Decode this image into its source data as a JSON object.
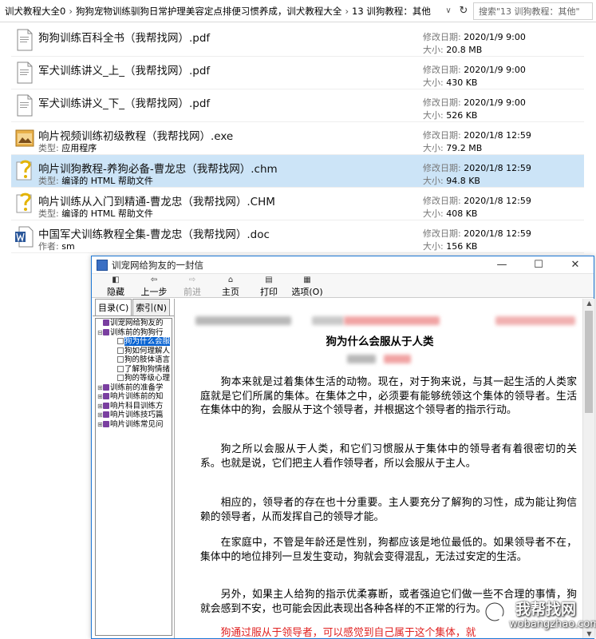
{
  "address_bar": {
    "crumbs": [
      "训犬教程大全0",
      "狗狗宠物训练驯狗日常护理美容定点排便习惯养成，训犬教程大全",
      "13 训狗教程：其他"
    ],
    "search_placeholder": "搜索\"13 训狗教程：其他\""
  },
  "files": [
    {
      "name": "狗狗训练百科全书（我帮找网）.pdf",
      "sub_label": "",
      "sub_value": "",
      "date_label": "修改日期:",
      "date": "2020/1/9 9:00",
      "size_label": "大小:",
      "size": "20.8 MB",
      "icon": "pdf-file-icon"
    },
    {
      "name": "军犬训练讲义_上_（我帮找网）.pdf",
      "sub_label": "",
      "sub_value": "",
      "date_label": "修改日期:",
      "date": "2020/1/9 9:00",
      "size_label": "大小:",
      "size": "430 KB",
      "icon": "pdf-file-icon"
    },
    {
      "name": "军犬训练讲义_下_（我帮找网）.pdf",
      "sub_label": "",
      "sub_value": "",
      "date_label": "修改日期:",
      "date": "2020/1/9 9:00",
      "size_label": "大小:",
      "size": "526 KB",
      "icon": "pdf-file-icon"
    },
    {
      "name": "响片视频训练初级教程（我帮找网）.exe",
      "sub_label": "类型:",
      "sub_value": "应用程序",
      "date_label": "修改日期:",
      "date": "2020/1/8 12:59",
      "size_label": "大小:",
      "size": "79.2 MB",
      "icon": "exe-file-icon"
    },
    {
      "name": "响片训狗教程-养狗必备-曹龙忠（我帮找网）.chm",
      "sub_label": "类型:",
      "sub_value": "编译的 HTML 帮助文件",
      "date_label": "修改日期:",
      "date": "2020/1/8 12:59",
      "size_label": "大小:",
      "size": "94.8 KB",
      "icon": "chm-file-icon"
    },
    {
      "name": "响片训练从入门到精通-曹龙忠（我帮找网）.CHM",
      "sub_label": "类型:",
      "sub_value": "编译的 HTML 帮助文件",
      "date_label": "修改日期:",
      "date": "2020/1/8 12:59",
      "size_label": "大小:",
      "size": "408 KB",
      "icon": "chm-file-icon"
    },
    {
      "name": "中国军犬训练教程全集-曹龙忠（我帮找网）.doc",
      "sub_label": "作者:",
      "sub_value": "sm",
      "date_label": "修改日期:",
      "date": "2020/1/8 12:59",
      "size_label": "大小:",
      "size": "156 KB",
      "icon": "word-file-icon"
    }
  ],
  "selected_file_index": 4,
  "help_window": {
    "title": "训宠网给狗友的一封信",
    "toolbar": [
      {
        "label": "隐藏",
        "icon": "hide-icon",
        "disabled": false
      },
      {
        "label": "上一步",
        "icon": "back-icon",
        "disabled": false
      },
      {
        "label": "前进",
        "icon": "forward-icon",
        "disabled": true
      },
      {
        "label": "主页",
        "icon": "home-icon",
        "disabled": false
      },
      {
        "label": "打印",
        "icon": "print-icon",
        "disabled": false
      },
      {
        "label": "选项(O)",
        "icon": "options-icon",
        "disabled": false
      }
    ],
    "tabs": [
      "目录(C)",
      "索引(N)"
    ],
    "tree": [
      {
        "label": "训宠网给狗友的",
        "level": 0,
        "box": "",
        "kind": "book",
        "hl": false
      },
      {
        "label": "训练前的狗狗行",
        "level": 0,
        "box": "⊟",
        "kind": "book",
        "hl": false
      },
      {
        "label": "狗为什么会服",
        "level": 1,
        "box": "",
        "kind": "page",
        "hl": true
      },
      {
        "label": "狗如何理解人",
        "level": 1,
        "box": "",
        "kind": "page",
        "hl": false
      },
      {
        "label": "狗的肢体语言",
        "level": 1,
        "box": "",
        "kind": "page",
        "hl": false
      },
      {
        "label": "了解狗狗情绪",
        "level": 1,
        "box": "",
        "kind": "page",
        "hl": false
      },
      {
        "label": "狗的等级心理",
        "level": 1,
        "box": "",
        "kind": "page",
        "hl": false
      },
      {
        "label": "训练前的准备学",
        "level": 0,
        "box": "⊞",
        "kind": "book",
        "hl": false
      },
      {
        "label": "响片训练前的知",
        "level": 0,
        "box": "⊞",
        "kind": "book",
        "hl": false
      },
      {
        "label": "响片科目训练方",
        "level": 0,
        "box": "⊞",
        "kind": "book",
        "hl": false
      },
      {
        "label": "响片训练技巧篇",
        "level": 0,
        "box": "⊞",
        "kind": "book",
        "hl": false
      },
      {
        "label": "响片训练常见问",
        "level": 0,
        "box": "⊞",
        "kind": "book",
        "hl": false
      }
    ],
    "doc_title": "狗为什么会服从于人类",
    "paragraphs": [
      "狗本来就是过着集体生活的动物。现在，对于狗来说，与其一起生活的人类家庭就是它们所属的集体。在集体之中，必须要有能够统领这个集体的领导者。生活在集体中的狗，会服从于这个领导者，并根据这个领导者的指示行动。",
      "狗之所以会服从于人类，和它们习惯服从于集体中的领导者有着很密切的关系。也就是说，它们把主人看作领导者，所以会服从于主人。",
      "相应的，领导者的存在也十分重要。主人要充分了解狗的习性，成为能让狗信赖的领导者，从而发挥自己的领导才能。",
      "在家庭中，不管是年龄还是性别，狗都应该是地位最低的。如果领导者不在，集体中的地位排列一旦发生变动，狗就会变得混乱，无法过安定的生活。",
      "另外，如果主人给狗的指示优柔寡断，或者强迫它们做一些不合理的事情，狗就会感到不安，也可能会因此表现出各种各样的不正常的行为。",
      "狗通过服从于领导者，可以感觉到自己属于这个集体，就"
    ]
  },
  "watermark": {
    "text": "我帮找网",
    "url": "wobangzhao.com"
  }
}
